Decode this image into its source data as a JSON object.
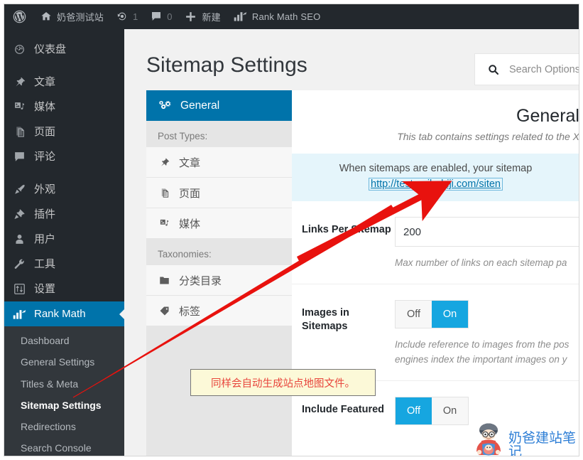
{
  "adminbar": {
    "logo_icon": "wordpress-logo-icon",
    "items": [
      {
        "icon": "home-icon",
        "label": "奶爸测试站",
        "count": null
      },
      {
        "icon": "updates-icon",
        "label": "",
        "count": "1"
      },
      {
        "icon": "comment-icon",
        "label": "",
        "count": "0"
      },
      {
        "icon": "plus-icon",
        "label": "新建",
        "count": null
      },
      {
        "icon": "rank-math-icon",
        "label": "Rank Math SEO",
        "count": null
      }
    ]
  },
  "sidebar": {
    "items": [
      {
        "icon": "dashboard-icon",
        "label": "仪表盘",
        "name": "dashboard",
        "current": false,
        "gap_after": true
      },
      {
        "icon": "pin-icon",
        "label": "文章",
        "name": "posts",
        "current": false,
        "gap_after": false
      },
      {
        "icon": "media-icon",
        "label": "媒体",
        "name": "media",
        "current": false,
        "gap_after": false
      },
      {
        "icon": "page-icon",
        "label": "页面",
        "name": "pages",
        "current": false,
        "gap_after": false
      },
      {
        "icon": "comment-icon",
        "label": "评论",
        "name": "comments",
        "current": false,
        "gap_after": true
      },
      {
        "icon": "appearance-icon",
        "label": "外观",
        "name": "appearance",
        "current": false,
        "gap_after": false
      },
      {
        "icon": "plugin-icon",
        "label": "插件",
        "name": "plugins",
        "current": false,
        "gap_after": false
      },
      {
        "icon": "users-icon",
        "label": "用户",
        "name": "users",
        "current": false,
        "gap_after": false
      },
      {
        "icon": "tools-icon",
        "label": "工具",
        "name": "tools",
        "current": false,
        "gap_after": false
      },
      {
        "icon": "settings-icon",
        "label": "设置",
        "name": "settings",
        "current": false,
        "gap_after": false
      },
      {
        "icon": "rank-math-icon",
        "label": "Rank Math",
        "name": "rank-math",
        "current": true,
        "gap_after": false
      }
    ],
    "submenu": [
      {
        "label": "Dashboard",
        "current": false
      },
      {
        "label": "General Settings",
        "current": false
      },
      {
        "label": "Titles & Meta",
        "current": false
      },
      {
        "label": "Sitemap Settings",
        "current": true
      },
      {
        "label": "Redirections",
        "current": false
      },
      {
        "label": "Search Console",
        "current": false
      }
    ]
  },
  "page": {
    "title": "Sitemap Settings"
  },
  "search": {
    "icon": "search-icon",
    "placeholder": "Search Options",
    "value": ""
  },
  "tabs": {
    "main": {
      "icon": "gears-icon",
      "label": "General"
    },
    "groups": [
      {
        "label": "Post Types:",
        "items": [
          {
            "icon": "pin-icon",
            "label": "文章"
          },
          {
            "icon": "page-icon",
            "label": "页面"
          },
          {
            "icon": "media-icon",
            "label": "媒体"
          }
        ]
      },
      {
        "label": "Taxonomies:",
        "items": [
          {
            "icon": "folder-icon",
            "label": "分类目录"
          },
          {
            "icon": "tag-icon",
            "label": "标签"
          }
        ]
      }
    ]
  },
  "panel": {
    "title": "General",
    "description": "This tab contains settings related to the X",
    "notice": {
      "text": "When sitemaps are enabled, your sitemap",
      "link": "http://test.naibabiji.com/siten"
    },
    "rows": [
      {
        "name": "links-per-sitemap",
        "label": "Links Per Sitemap",
        "type": "text",
        "value": "200",
        "help": "Max number of links on each sitemap pa"
      },
      {
        "name": "images-in-sitemaps",
        "label": "Images in Sitemaps",
        "type": "toggle",
        "off_label": "Off",
        "on_label": "On",
        "active": "on",
        "help": "Include reference to images from the pos engines index the important images on y"
      },
      {
        "name": "include-featured",
        "label": "Include Featured",
        "type": "toggle",
        "off_label": "Off",
        "on_label": "On",
        "active": "off",
        "help": ""
      }
    ]
  },
  "annotation": {
    "callout_text": "同样会自动生成站点地图文件。",
    "arrow_color": "#e8120e"
  },
  "watermark": {
    "text": "奶爸建站笔记",
    "icon": "mascot-icon"
  },
  "colors": {
    "accent": "#0073aa",
    "toggle_on": "#16a6e0",
    "admin_dark": "#23282d",
    "submenu_dark": "#32373c",
    "notice_bg": "#e5f5fb",
    "callout_bg": "#fcf9d8",
    "callout_text": "#e8453c",
    "watermark_text": "#2f7fd6"
  }
}
